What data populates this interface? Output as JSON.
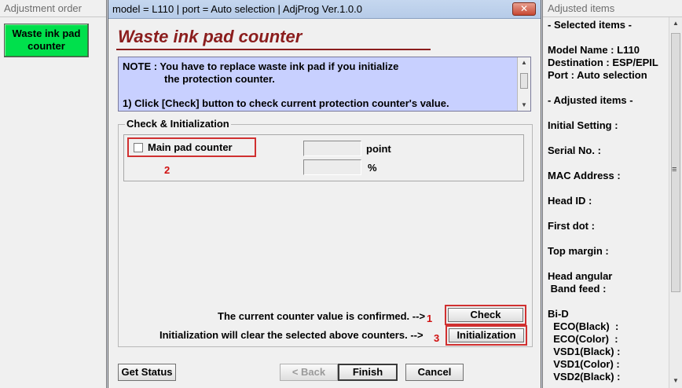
{
  "left_panel": {
    "title": "Adjustment order",
    "active_item": "Waste ink pad counter"
  },
  "window": {
    "title": "model = L110 | port = Auto selection | AdjProg Ver.1.0.0",
    "close_glyph": "✕",
    "page_title": "Waste ink pad counter",
    "note": {
      "line1": "NOTE : You have to replace waste ink pad if you initialize",
      "line2": "the protection counter.",
      "line3": "1) Click [Check] button to check current protection counter's value."
    },
    "group": {
      "label": "Check & Initialization",
      "main_pad_label": "Main pad counter",
      "main_pad_checked": false,
      "annotation_2": "2",
      "point_unit": "point",
      "percent_unit": "%",
      "point_value": "",
      "percent_value": ""
    },
    "check_message": "The current counter value is confirmed. -->",
    "annotation_1": "1",
    "check_label": "Check",
    "init_message": "Initialization will clear the selected above counters. -->",
    "annotation_3": "3",
    "init_label": "Initialization",
    "footer": {
      "get_status": "Get Status",
      "back": "< Back",
      "finish": "Finish",
      "cancel": "Cancel"
    }
  },
  "right_panel": {
    "title": "Adjusted items",
    "lines": [
      "- Selected items -",
      "Model Name : L110",
      "Destination : ESP/EPIL",
      "Port : Auto selection",
      "- Adjusted items -",
      "Initial Setting :",
      "Serial No. :",
      "MAC Address :",
      "Head ID :",
      "First dot :",
      "Top margin :",
      "Head angular",
      " Band feed :",
      "Bi-D",
      "  ECO(Black)  :",
      "  ECO(Color)  :",
      "  VSD1(Black) :",
      "  VSD1(Color) :",
      "  VSD2(Black) :"
    ]
  },
  "colors": {
    "active_item_bg": "#00e04c",
    "title_text": "#8b1d1d",
    "note_bg": "#c8d0ff",
    "highlight": "#d03030"
  },
  "icons": {
    "scroll_up": "▲",
    "scroll_down": "▼",
    "scroll_grip": "≡"
  }
}
